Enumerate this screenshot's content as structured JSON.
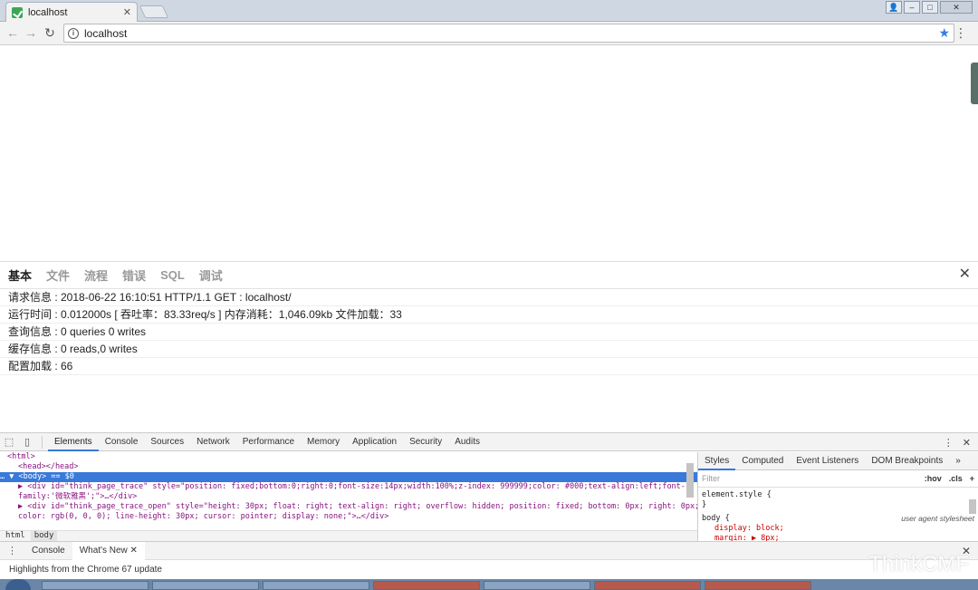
{
  "browser": {
    "tab_title": "localhost",
    "tab_close": "✕",
    "url": "localhost",
    "nav": {
      "back": "←",
      "forward": "→",
      "reload": "↻"
    },
    "star": "★",
    "menu": "⋮"
  },
  "trace": {
    "tabs": [
      "基本",
      "文件",
      "流程",
      "错误",
      "SQL",
      "调试"
    ],
    "active_tab": "基本",
    "close": "✕",
    "rows": [
      "请求信息 : 2018-06-22 16:10:51 HTTP/1.1 GET : localhost/",
      "运行时间 : 0.012000s [ 吞吐率：83.33req/s ] 内存消耗：1,046.09kb 文件加载：33",
      "查询信息 : 0 queries 0 writes",
      "缓存信息 : 0 reads,0 writes",
      "配置加载 : 66"
    ]
  },
  "devtools": {
    "tabs": [
      "Elements",
      "Console",
      "Sources",
      "Network",
      "Performance",
      "Memory",
      "Application",
      "Security",
      "Audits"
    ],
    "active_tab": "Elements",
    "elements": {
      "line1": "<html>",
      "line2": "<head></head>",
      "line3": "… ▼ <body> == $0",
      "line4a": "▶ <div id=\"think_page_trace\" style=\"position: fixed;bottom:0;right:0;font-size:14px;width:100%;z-index: 999999;color: #000;text-align:left;font-",
      "line4b": "family:'微软雅黑';\">…</div>",
      "line5a": "▶ <div id=\"think_page_trace_open\" style=\"height: 30px; float: right; text-align: right; overflow: hidden; position: fixed; bottom: 0px; right: 0px;",
      "line5b": "color: rgb(0, 0, 0); line-height: 30px; cursor: pointer; display: none;\">…</div>"
    },
    "breadcrumb": [
      "html",
      "body"
    ],
    "styles_tabs": [
      "Styles",
      "Computed",
      "Event Listeners",
      "DOM Breakpoints"
    ],
    "styles_more": "»",
    "filter_placeholder": "Filter",
    "hov": ":hov",
    "cls": ".cls",
    "plus": "+",
    "code": {
      "element_style": "element.style {",
      "close_brace": "}",
      "body_rule": "body {",
      "ua": "user agent stylesheet",
      "prop1": "display: block;",
      "prop2": "margin: ▶ 8px;"
    },
    "drawer_tabs": [
      "Console",
      "What's New"
    ],
    "drawer_close_tab": "✕",
    "drawer_message": "Highlights from the Chrome 67 update"
  },
  "watermark": "ThinkCMF"
}
